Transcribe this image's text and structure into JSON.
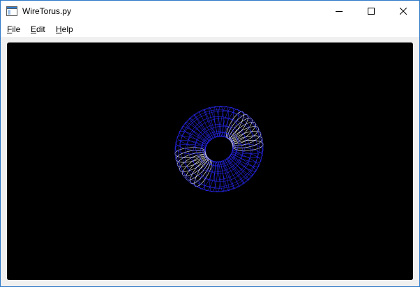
{
  "window": {
    "title": "WireTorus.py"
  },
  "titlebar_buttons": {
    "minimize_icon": "minimize-icon",
    "maximize_icon": "maximize-icon",
    "close_icon": "close-icon"
  },
  "menu": [
    {
      "label_first": "F",
      "label_rest": "ile"
    },
    {
      "label_first": "E",
      "label_rest": "dit"
    },
    {
      "label_first": "H",
      "label_rest": "elp"
    }
  ],
  "viewport": {
    "background": "#000000",
    "wire_color": "#2a2aff",
    "highlight_color": "#ffffff",
    "model": "wire-torus"
  }
}
